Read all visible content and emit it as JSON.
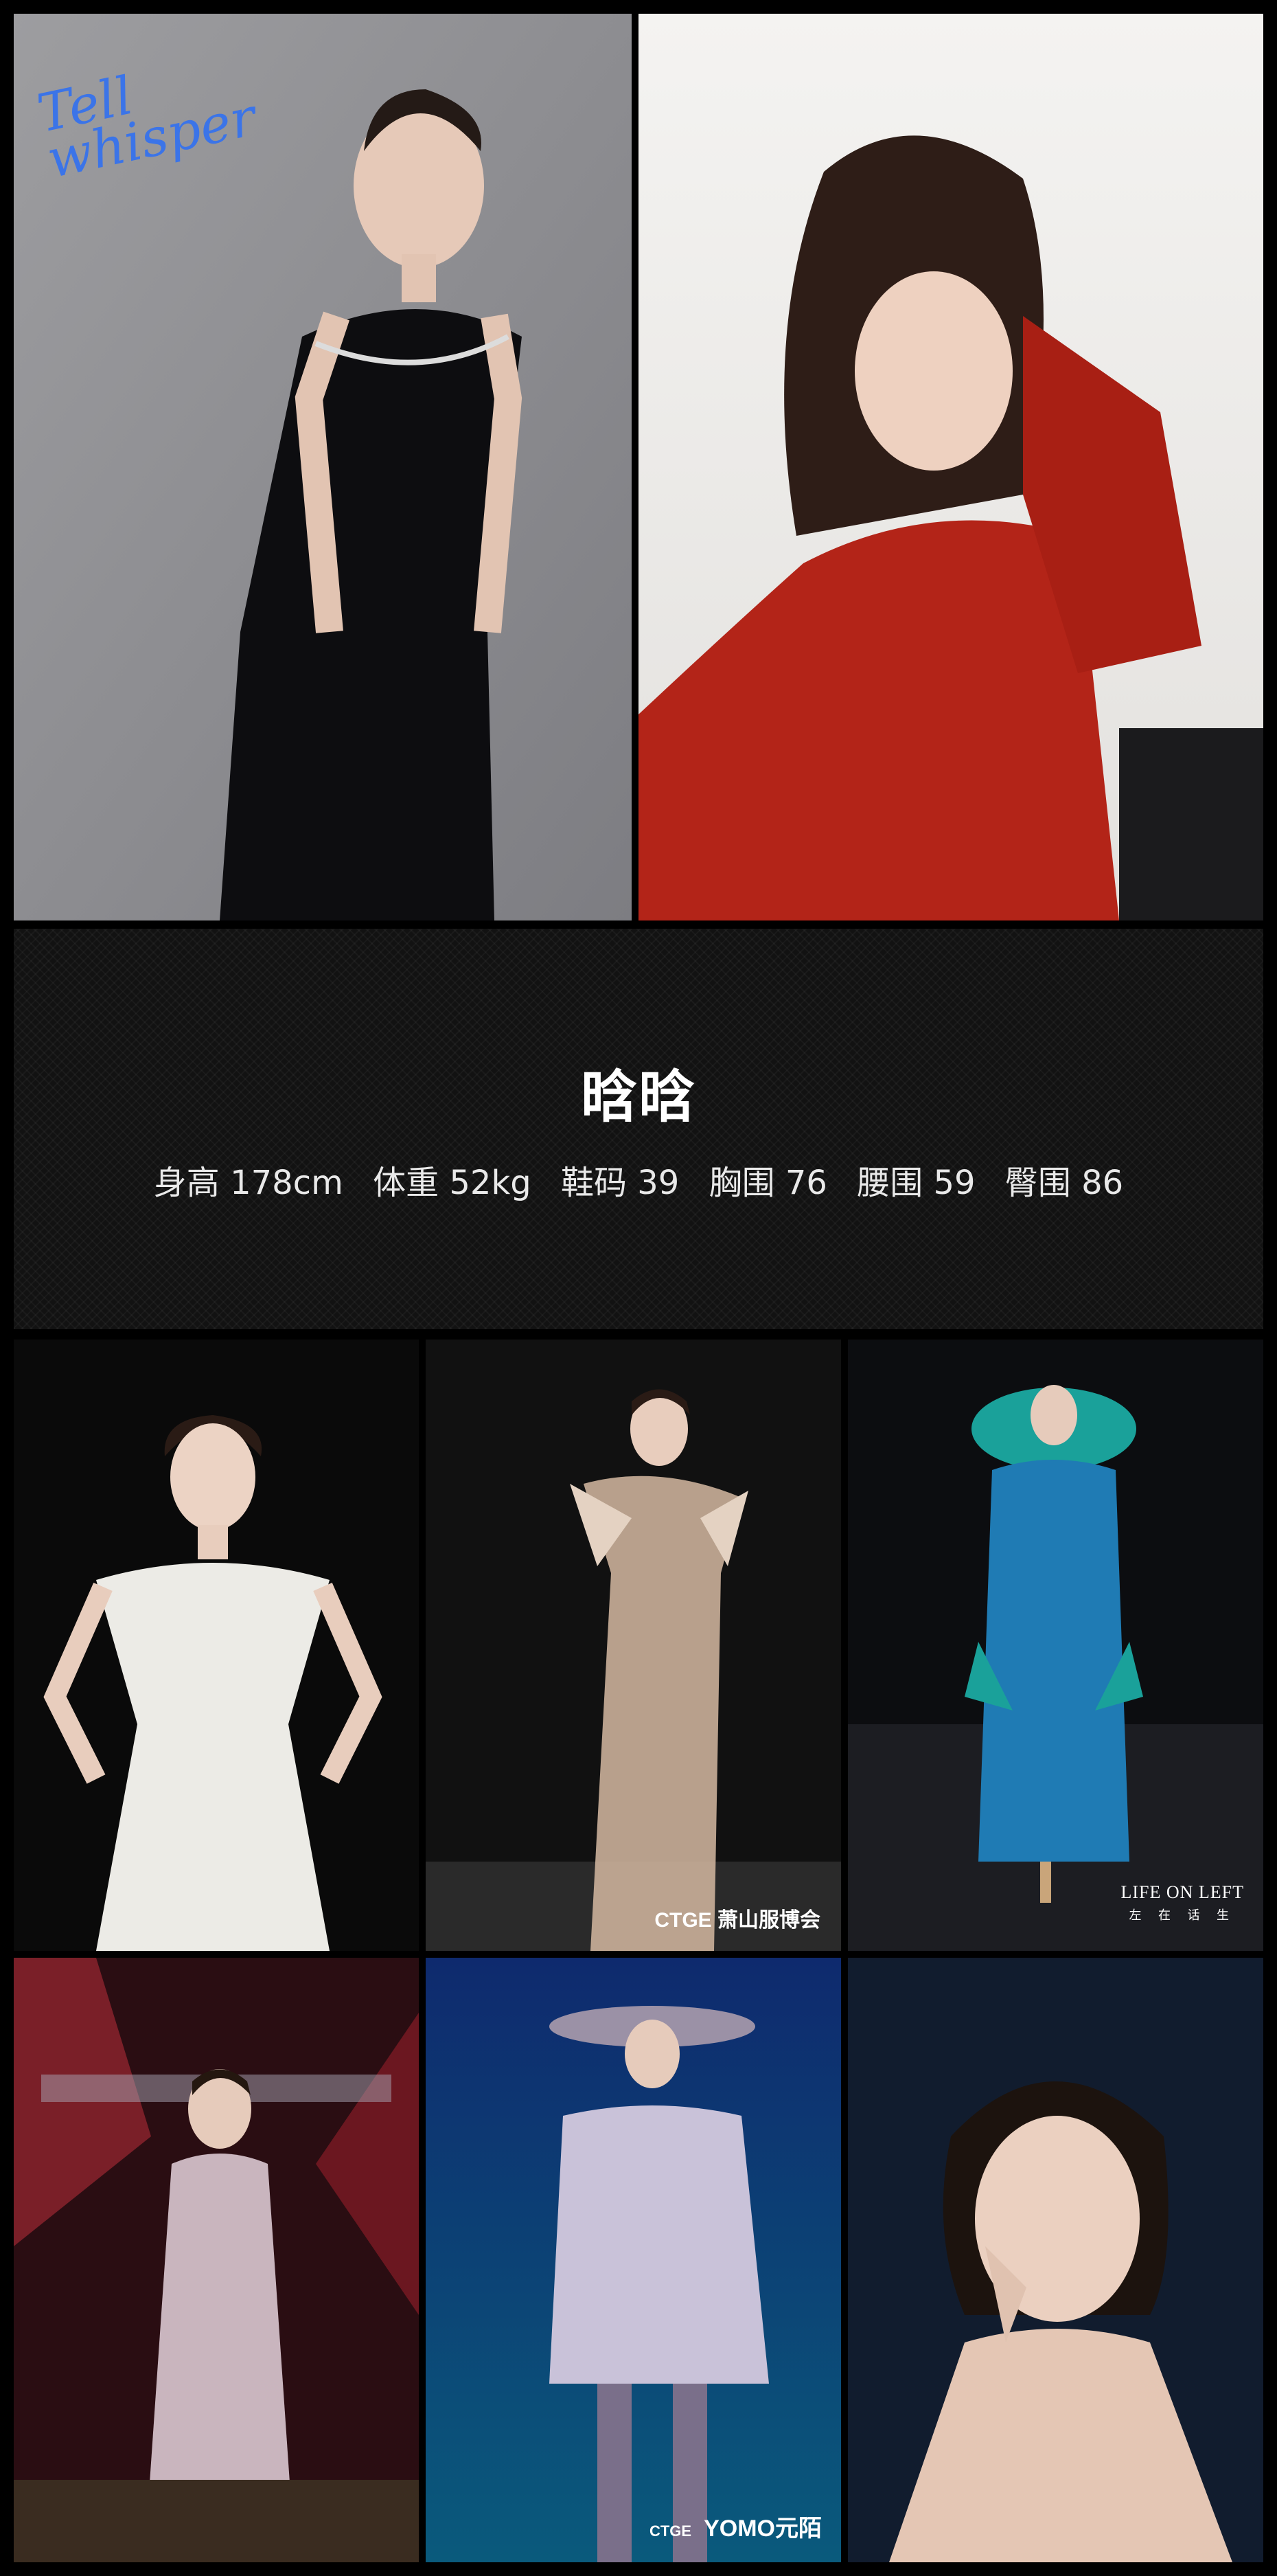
{
  "profile": {
    "name": "晗晗",
    "stats": [
      {
        "label": "身高",
        "value": "178cm"
      },
      {
        "label": "体重",
        "value": "52kg"
      },
      {
        "label": "鞋码",
        "value": "39"
      },
      {
        "label": "胸围",
        "value": "76"
      },
      {
        "label": "腰围",
        "value": "59"
      },
      {
        "label": "臀围",
        "value": "86"
      }
    ]
  },
  "photos": [
    {
      "subject": "black sequin gown on grey backdrop",
      "signature": "Tell whisper"
    },
    {
      "subject": "red off-shoulder dress portrait"
    },
    {
      "subject": "white bridal gown on black backdrop"
    },
    {
      "subject": "sheer nude ruffle gown",
      "watermark": "CTGE 萧山服博会"
    },
    {
      "subject": "teal runway look",
      "watermark": "LIFE ON LEFT",
      "watermark_sub": "左 在 话 生"
    },
    {
      "subject": "silver crystal gown on stage"
    },
    {
      "subject": "lavender trench and wide-brim hat",
      "watermark_small": "CTGE",
      "watermark": "YOMO元陌"
    },
    {
      "subject": "close-up beauty portrait with earrings"
    }
  ],
  "colors": {
    "background": "#000000",
    "band": "#121212",
    "text": "#ffffff",
    "signature": "#3b74e8"
  }
}
